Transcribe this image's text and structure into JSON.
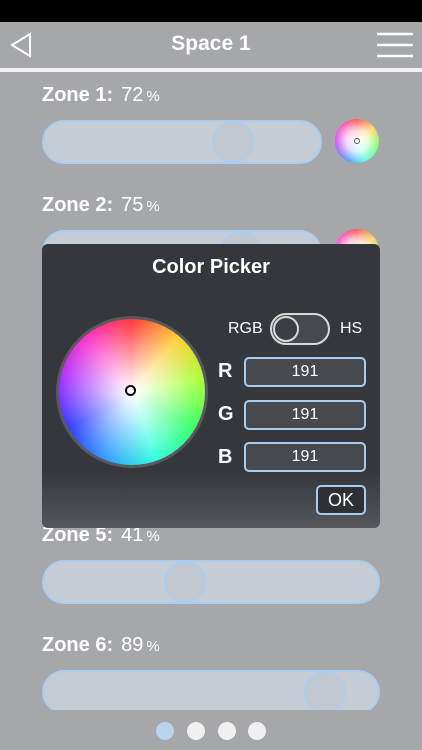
{
  "nav": {
    "title": "Space 1",
    "back_icon": "back-triangle-icon",
    "menu_icon": "hamburger-menu-icon"
  },
  "zones": [
    {
      "name": "Zone 1:",
      "value": "72",
      "unit": "%",
      "level": 0.72
    },
    {
      "name": "Zone 2:",
      "value": "75",
      "unit": "%",
      "level": 0.75
    },
    {
      "name": "Zone 5:",
      "value": "41",
      "unit": "%",
      "level": 0.41
    },
    {
      "name": "Zone 6:",
      "value": "89",
      "unit": "%",
      "level": 0.89
    }
  ],
  "picker": {
    "title": "Color Picker",
    "mode_left": "RGB",
    "mode_right": "HS",
    "channels": [
      {
        "label": "R",
        "value": "191"
      },
      {
        "label": "G",
        "value": "191"
      },
      {
        "label": "B",
        "value": "191"
      }
    ],
    "ok_label": "OK"
  },
  "pager": {
    "count": 4,
    "active": 0
  },
  "colors": {
    "background": "#a6a7aa",
    "dialog": "#34373c",
    "accent_border": "#a9cdf0",
    "track": "#c6ccd3"
  }
}
